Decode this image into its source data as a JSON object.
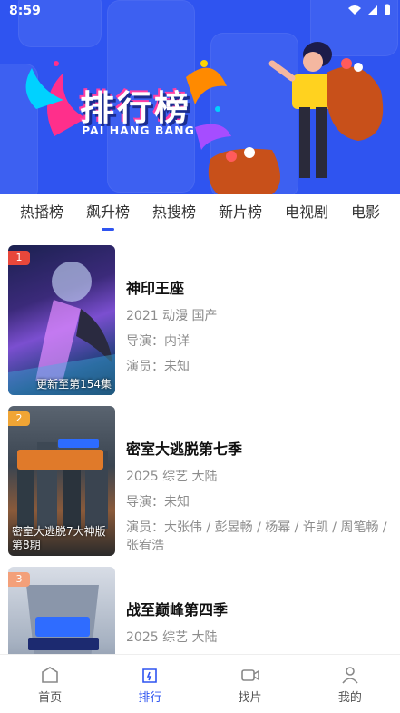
{
  "status": {
    "time": "8:59"
  },
  "hero": {
    "title": "排行榜",
    "subtitle": "PAI HANG BANG",
    "accent": "#2f54f0"
  },
  "tabs": [
    {
      "label": "热播榜",
      "active": false
    },
    {
      "label": "飙升榜",
      "active": true
    },
    {
      "label": "热搜榜",
      "active": false
    },
    {
      "label": "新片榜",
      "active": false
    },
    {
      "label": "电视剧",
      "active": false
    },
    {
      "label": "电影",
      "active": false
    }
  ],
  "items": [
    {
      "rank": "1",
      "rank_color": "#e8473b",
      "title": "神印王座",
      "year_type_region": "2021 动漫 国产",
      "director": "导演：内详",
      "cast": "演员：未知",
      "poster_caption": "更新至第154集"
    },
    {
      "rank": "2",
      "rank_color": "#f0a535",
      "title": "密室大逃脱第七季",
      "year_type_region": "2025 综艺 大陆",
      "director": "导演：未知",
      "cast": "演员：大张伟 / 彭昱畅 / 杨幂 / 许凯 / 周笔畅 / 张宥浩",
      "poster_caption": "密室大逃脱7大神版第8期"
    },
    {
      "rank": "3",
      "rank_color": "#f3a07a",
      "title": "战至巅峰第四季",
      "year_type_region": "2025 综艺 大陆",
      "director": "",
      "cast": "",
      "poster_caption": ""
    }
  ],
  "bottom_nav": [
    {
      "label": "首页",
      "icon": "home-icon",
      "active": false
    },
    {
      "label": "排行",
      "icon": "ranking-icon",
      "active": true
    },
    {
      "label": "找片",
      "icon": "video-camera-icon",
      "active": false
    },
    {
      "label": "我的",
      "icon": "user-icon",
      "active": false
    }
  ]
}
